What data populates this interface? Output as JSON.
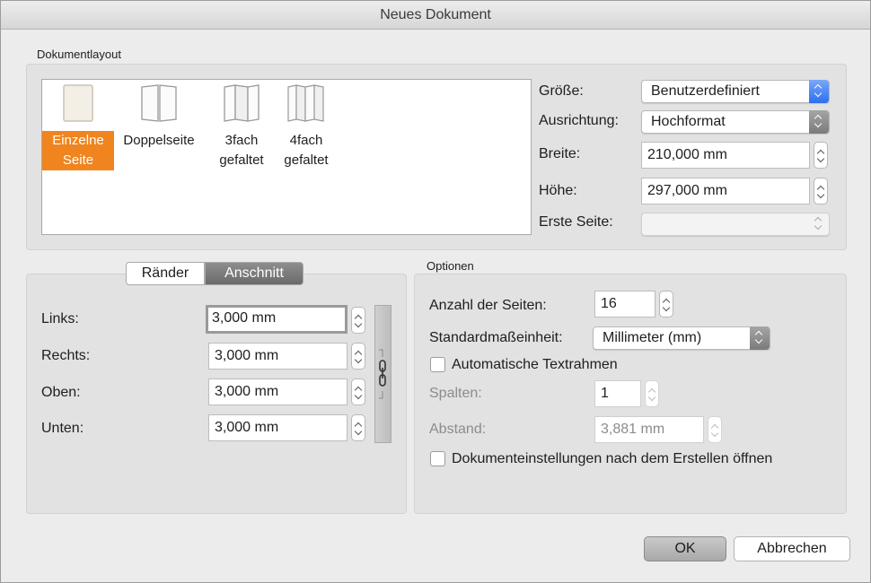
{
  "window": {
    "title": "Neues Dokument"
  },
  "layout": {
    "section_label": "Dokumentlayout",
    "items": [
      {
        "line1": "Einzelne",
        "line2": "Seite",
        "selected": true
      },
      {
        "line1": "Doppelseite",
        "line2": "",
        "selected": false
      },
      {
        "line1": "3fach",
        "line2": "gefaltet",
        "selected": false
      },
      {
        "line1": "4fach",
        "line2": "gefaltet",
        "selected": false
      }
    ]
  },
  "page": {
    "size_label": "Größe:",
    "size_value": "Benutzerdefiniert",
    "orientation_label": "Ausrichtung:",
    "orientation_value": "Hochformat",
    "width_label": "Breite:",
    "width_value": "210,000 mm",
    "height_label": "Höhe:",
    "height_value": "297,000 mm",
    "first_page_label": "Erste Seite:",
    "first_page_value": ""
  },
  "margins": {
    "tabs": [
      {
        "label": "Ränder",
        "active": false
      },
      {
        "label": "Anschnitt",
        "active": true
      }
    ],
    "left_label": "Links:",
    "left_value": "3,000 mm",
    "right_label": "Rechts:",
    "right_value": "3,000 mm",
    "top_label": "Oben:",
    "top_value": "3,000 mm",
    "bottom_label": "Unten:",
    "bottom_value": "3,000 mm"
  },
  "options": {
    "section_label": "Optionen",
    "pages_label": "Anzahl der Seiten:",
    "pages_value": "16",
    "unit_label": "Standardmaßeinheit:",
    "unit_value": "Millimeter (mm)",
    "auto_text_label": "Automatische Textrahmen",
    "auto_text_checked": false,
    "columns_label": "Spalten:",
    "columns_value": "1",
    "gutter_label": "Abstand:",
    "gutter_value": "3,881 mm",
    "open_settings_label": "Dokumenteinstellungen nach dem Erstellen öffnen",
    "open_settings_checked": false
  },
  "buttons": {
    "ok": "OK",
    "cancel": "Abbrechen"
  },
  "colors": {
    "selection": "#f0841e",
    "accent": "#2d6ff0"
  }
}
